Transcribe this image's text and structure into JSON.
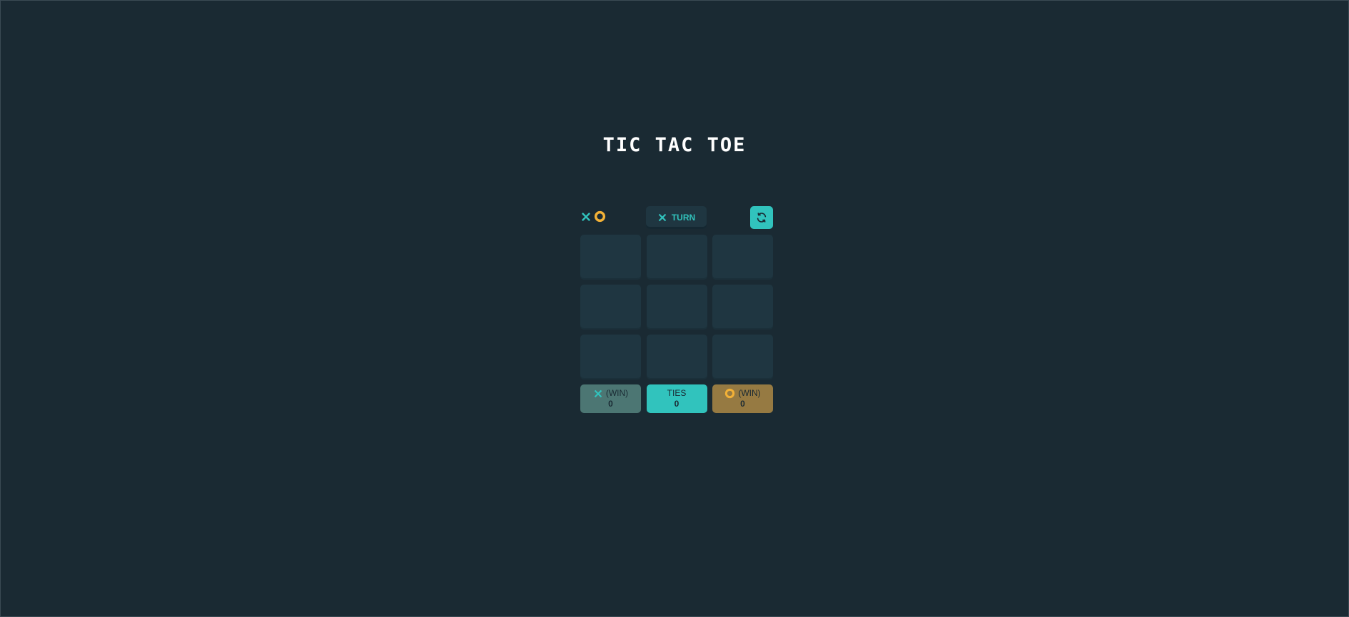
{
  "title": "TIC TAC TOE",
  "logo": {
    "icons": [
      "x-icon",
      "o-icon"
    ]
  },
  "turn": {
    "icon": "x-icon",
    "label": "TURN"
  },
  "restart": {
    "icon": "refresh-icon"
  },
  "board": {
    "cells": [
      "",
      "",
      "",
      "",
      "",
      "",
      "",
      "",
      ""
    ]
  },
  "scores": {
    "x": {
      "icon": "x-icon",
      "label": "(WIN)",
      "value": "0"
    },
    "ties": {
      "label": "TIES",
      "value": "0"
    },
    "o": {
      "icon": "o-icon",
      "label": "(WIN)",
      "value": "0"
    }
  },
  "colors": {
    "background": "#1a2a33",
    "cell": "#1f3641",
    "x": "#31c3bd",
    "o": "#f2b137",
    "score_x": "#4c7673",
    "score_ties": "#31c3bd",
    "score_o": "#967a42"
  }
}
